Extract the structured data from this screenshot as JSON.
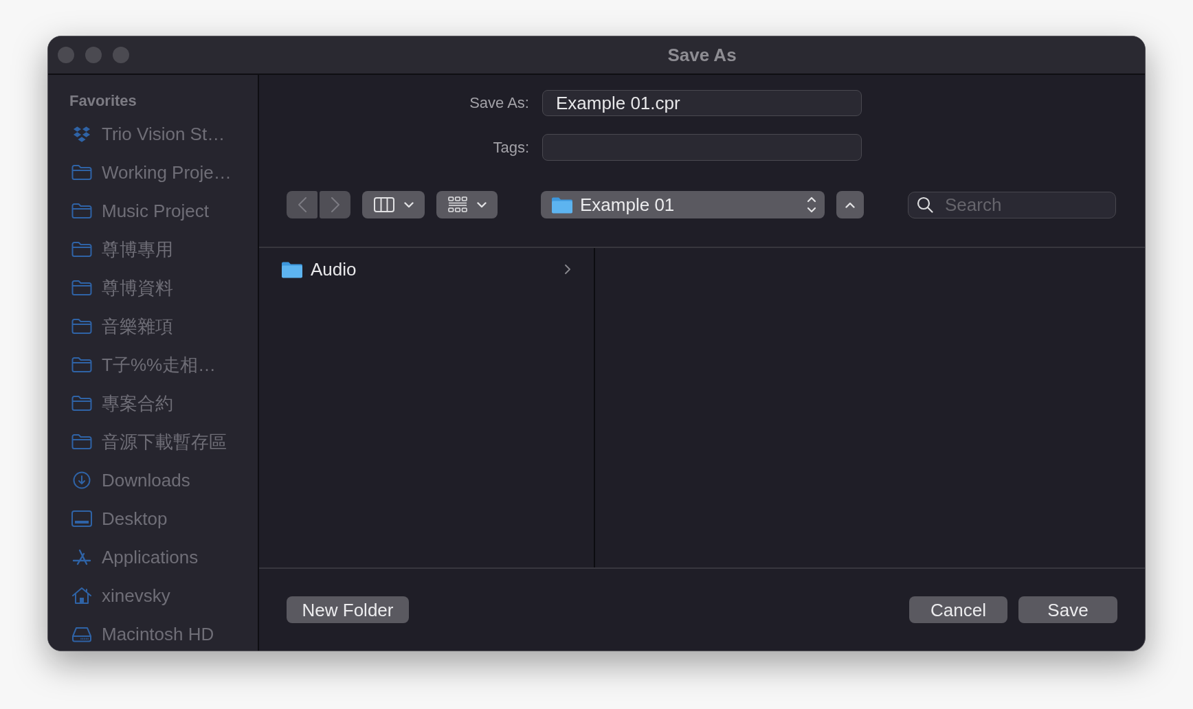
{
  "window": {
    "title": "Save As"
  },
  "sidebar": {
    "heading": "Favorites",
    "items": [
      {
        "label": "Trio Vision St…",
        "kind": "diamonds",
        "selected": false
      },
      {
        "label": "Working Proje…",
        "kind": "folder",
        "selected": false
      },
      {
        "label": "Music Project",
        "kind": "folder",
        "selected": false
      },
      {
        "label": "尊博專用",
        "kind": "folder",
        "selected": false
      },
      {
        "label": "尊博資料",
        "kind": "folder",
        "selected": false
      },
      {
        "label": "音樂雜項",
        "kind": "folder",
        "selected": false
      },
      {
        "label": "T子%%走相…",
        "kind": "folder",
        "selected": false
      },
      {
        "label": "專案合約",
        "kind": "folder",
        "selected": false
      },
      {
        "label": "音源下載暫存區",
        "kind": "folder",
        "selected": false
      },
      {
        "label": "Downloads",
        "kind": "download",
        "selected": false
      },
      {
        "label": "Desktop",
        "kind": "desktop",
        "selected": false
      },
      {
        "label": "Applications",
        "kind": "apps",
        "selected": false
      },
      {
        "label": "xinevsky",
        "kind": "home",
        "selected": false
      },
      {
        "label": "Macintosh HD",
        "kind": "drive",
        "selected": false
      }
    ]
  },
  "save_as": {
    "label": "Save As:",
    "value": "Example 01.cpr"
  },
  "tags": {
    "label": "Tags:"
  },
  "toolbar": {
    "back": {
      "disabled": true
    },
    "forward": {
      "disabled": true
    },
    "location": "Example 01",
    "search": {
      "placeholder": "Search"
    }
  },
  "browser": {
    "items": [
      {
        "name": "Audio",
        "selected": false
      }
    ]
  },
  "footer": {
    "new_folder": "New Folder",
    "cancel": "Cancel",
    "save": "Save"
  }
}
